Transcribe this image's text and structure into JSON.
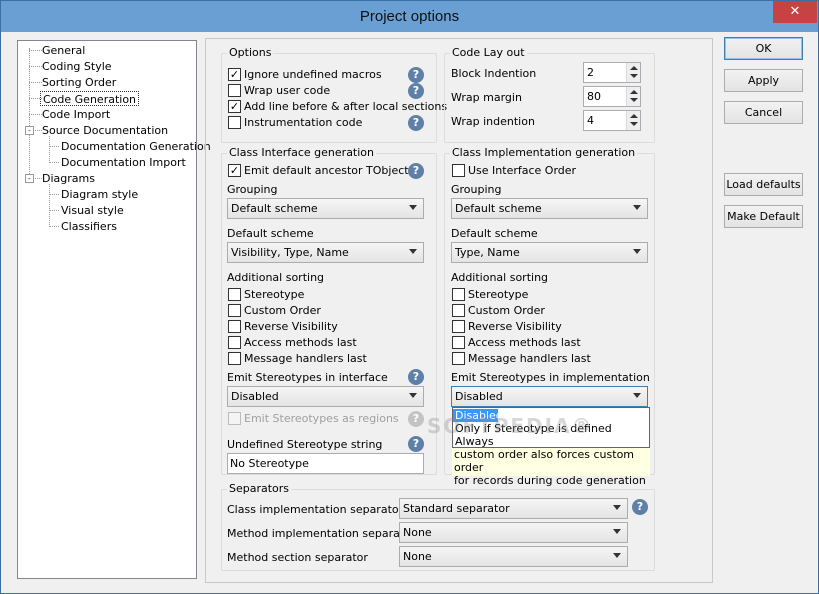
{
  "window": {
    "title": "Project options",
    "close": "✕"
  },
  "tree": {
    "general": "General",
    "coding_style": "Coding Style",
    "sorting_order": "Sorting Order",
    "code_generation": "Code Generation",
    "code_import": "Code Import",
    "source_documentation": "Source Documentation",
    "documentation_generation": "Documentation Generation",
    "documentation_import": "Documentation Import",
    "diagrams": "Diagrams",
    "diagram_style": "Diagram style",
    "visual_style": "Visual style",
    "classifiers": "Classifiers",
    "expander": "-"
  },
  "options": {
    "title": "Options",
    "ignore_macros": "Ignore undefined macros",
    "wrap_user_code": "Wrap user code",
    "add_line": "Add line before & after local sections",
    "instrumentation": "Instrumentation code",
    "check": "✓"
  },
  "layout": {
    "title": "Code Lay out",
    "block_indention": "Block Indention",
    "block_indention_value": "2",
    "wrap_margin": "Wrap margin",
    "wrap_margin_value": "80",
    "wrap_indention": "Wrap indention",
    "wrap_indention_value": "4"
  },
  "iface": {
    "title": "Class Interface generation",
    "emit_ancestor": "Emit default ancestor TObject",
    "grouping": "Grouping",
    "grouping_value": "Default scheme",
    "default_scheme": "Default scheme",
    "default_scheme_value": "Visibility, Type, Name",
    "additional_sorting": "Additional sorting",
    "stereotype": "Stereotype",
    "custom_order": "Custom Order",
    "reverse_visibility": "Reverse Visibility",
    "access_methods": "Access methods last",
    "message_handlers": "Message handlers last",
    "emit_stereo": "Emit Stereotypes in interface",
    "emit_stereo_value": "Disabled",
    "emit_regions": "Emit Stereotypes as regions",
    "undefined_string": "Undefined Stereotype string",
    "undefined_value": "No Stereotype"
  },
  "impl": {
    "title": "Class Implementation generation",
    "use_iface_order": "Use Interface Order",
    "grouping": "Grouping",
    "grouping_value": "Default scheme",
    "default_scheme": "Default scheme",
    "default_scheme_value": "Type, Name",
    "additional_sorting": "Additional sorting",
    "stereotype": "Stereotype",
    "custom_order": "Custom Order",
    "reverse_visibility": "Reverse Visibility",
    "access_methods": "Access methods last",
    "message_handlers": "Message handlers last",
    "emit_stereo": "Emit Stereotypes in implementation",
    "emit_stereo_value": "Disabled",
    "options": [
      "Disabled",
      "Only if Stereotype is defined",
      "Always"
    ],
    "hint_line1": "custom order also forces custom order",
    "hint_line2": "for records during code generation"
  },
  "separators": {
    "title": "Separators",
    "class_impl": "Class implementation separator",
    "class_impl_value": "Standard separator",
    "method_impl": "Method implementation separator",
    "method_impl_value": "None",
    "method_section": "Method section separator",
    "method_section_value": "None"
  },
  "buttons": {
    "ok": "OK",
    "apply": "Apply",
    "cancel": "Cancel",
    "load_defaults": "Load defaults",
    "make_default": "Make Default"
  },
  "help_glyph": "?",
  "watermark": "SOFTPEDIA®"
}
